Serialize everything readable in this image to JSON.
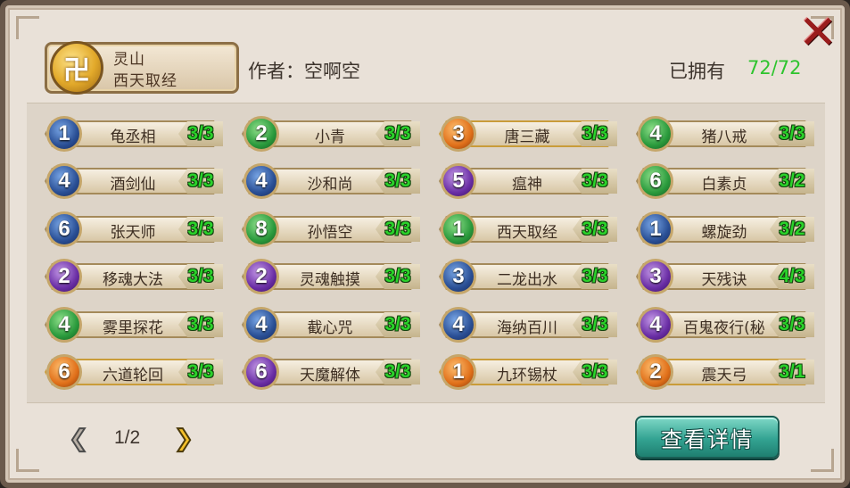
{
  "set": {
    "emblem": "卍",
    "name": "灵山",
    "subtitle": "西天取经"
  },
  "author_text": "作者：空啊空",
  "owned": {
    "label": "已拥有",
    "count": "72/72"
  },
  "close_label": "✕",
  "cards": [
    {
      "cost": "1",
      "color": "blue",
      "name": "龟丞相",
      "count": "3/3"
    },
    {
      "cost": "2",
      "color": "green",
      "name": "小青",
      "count": "3/3"
    },
    {
      "cost": "3",
      "color": "orange",
      "name": "唐三藏",
      "count": "3/3"
    },
    {
      "cost": "4",
      "color": "green",
      "name": "猪八戒",
      "count": "3/3"
    },
    {
      "cost": "4",
      "color": "blue",
      "name": "酒剑仙",
      "count": "3/3"
    },
    {
      "cost": "4",
      "color": "blue",
      "name": "沙和尚",
      "count": "3/3"
    },
    {
      "cost": "5",
      "color": "purple",
      "name": "瘟神",
      "count": "3/3"
    },
    {
      "cost": "6",
      "color": "green",
      "name": "白素贞",
      "count": "3/2"
    },
    {
      "cost": "6",
      "color": "blue",
      "name": "张天师",
      "count": "3/3"
    },
    {
      "cost": "8",
      "color": "green",
      "name": "孙悟空",
      "count": "3/3"
    },
    {
      "cost": "1",
      "color": "green",
      "name": "西天取经",
      "count": "3/3"
    },
    {
      "cost": "1",
      "color": "blue",
      "name": "螺旋劲",
      "count": "3/2"
    },
    {
      "cost": "2",
      "color": "purple",
      "name": "移魂大法",
      "count": "3/3"
    },
    {
      "cost": "2",
      "color": "purple",
      "name": "灵魂触摸",
      "count": "3/3"
    },
    {
      "cost": "3",
      "color": "blue",
      "name": "二龙出水",
      "count": "3/3"
    },
    {
      "cost": "3",
      "color": "purple",
      "name": "天残诀",
      "count": "4/3"
    },
    {
      "cost": "4",
      "color": "green",
      "name": "雾里探花",
      "count": "3/3"
    },
    {
      "cost": "4",
      "color": "blue",
      "name": "截心咒",
      "count": "3/3"
    },
    {
      "cost": "4",
      "color": "blue",
      "name": "海纳百川",
      "count": "3/3"
    },
    {
      "cost": "4",
      "color": "purple",
      "name": "百鬼夜行(秘",
      "count": "3/3"
    },
    {
      "cost": "6",
      "color": "orange",
      "name": "六道轮回",
      "count": "3/3"
    },
    {
      "cost": "6",
      "color": "purple",
      "name": "天魔解体",
      "count": "3/3"
    },
    {
      "cost": "1",
      "color": "orange",
      "name": "九环锡杖",
      "count": "3/3"
    },
    {
      "cost": "2",
      "color": "orange",
      "name": "震天弓",
      "count": "3/1"
    }
  ],
  "pager": {
    "prev_icon": "chevron-left-icon",
    "text": "1/2",
    "next_icon": "chevron-right-icon"
  },
  "detail_button": "查看详情"
}
